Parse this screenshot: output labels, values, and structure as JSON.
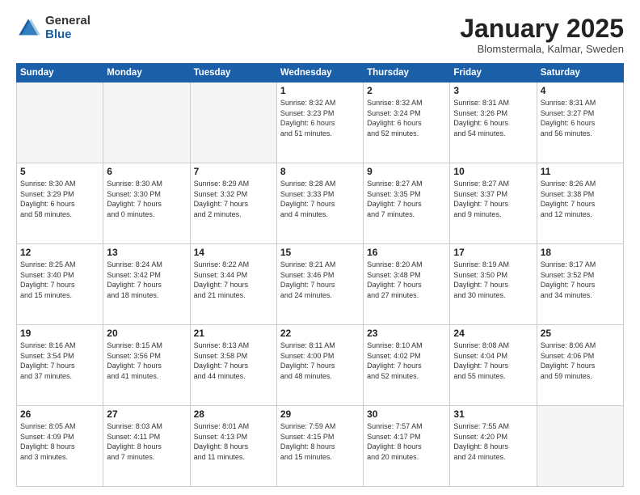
{
  "logo": {
    "general": "General",
    "blue": "Blue"
  },
  "header": {
    "month": "January 2025",
    "location": "Blomstermala, Kalmar, Sweden"
  },
  "days_of_week": [
    "Sunday",
    "Monday",
    "Tuesday",
    "Wednesday",
    "Thursday",
    "Friday",
    "Saturday"
  ],
  "weeks": [
    [
      {
        "day": "",
        "info": ""
      },
      {
        "day": "",
        "info": ""
      },
      {
        "day": "",
        "info": ""
      },
      {
        "day": "1",
        "info": "Sunrise: 8:32 AM\nSunset: 3:23 PM\nDaylight: 6 hours\nand 51 minutes."
      },
      {
        "day": "2",
        "info": "Sunrise: 8:32 AM\nSunset: 3:24 PM\nDaylight: 6 hours\nand 52 minutes."
      },
      {
        "day": "3",
        "info": "Sunrise: 8:31 AM\nSunset: 3:26 PM\nDaylight: 6 hours\nand 54 minutes."
      },
      {
        "day": "4",
        "info": "Sunrise: 8:31 AM\nSunset: 3:27 PM\nDaylight: 6 hours\nand 56 minutes."
      }
    ],
    [
      {
        "day": "5",
        "info": "Sunrise: 8:30 AM\nSunset: 3:29 PM\nDaylight: 6 hours\nand 58 minutes."
      },
      {
        "day": "6",
        "info": "Sunrise: 8:30 AM\nSunset: 3:30 PM\nDaylight: 7 hours\nand 0 minutes."
      },
      {
        "day": "7",
        "info": "Sunrise: 8:29 AM\nSunset: 3:32 PM\nDaylight: 7 hours\nand 2 minutes."
      },
      {
        "day": "8",
        "info": "Sunrise: 8:28 AM\nSunset: 3:33 PM\nDaylight: 7 hours\nand 4 minutes."
      },
      {
        "day": "9",
        "info": "Sunrise: 8:27 AM\nSunset: 3:35 PM\nDaylight: 7 hours\nand 7 minutes."
      },
      {
        "day": "10",
        "info": "Sunrise: 8:27 AM\nSunset: 3:37 PM\nDaylight: 7 hours\nand 9 minutes."
      },
      {
        "day": "11",
        "info": "Sunrise: 8:26 AM\nSunset: 3:38 PM\nDaylight: 7 hours\nand 12 minutes."
      }
    ],
    [
      {
        "day": "12",
        "info": "Sunrise: 8:25 AM\nSunset: 3:40 PM\nDaylight: 7 hours\nand 15 minutes."
      },
      {
        "day": "13",
        "info": "Sunrise: 8:24 AM\nSunset: 3:42 PM\nDaylight: 7 hours\nand 18 minutes."
      },
      {
        "day": "14",
        "info": "Sunrise: 8:22 AM\nSunset: 3:44 PM\nDaylight: 7 hours\nand 21 minutes."
      },
      {
        "day": "15",
        "info": "Sunrise: 8:21 AM\nSunset: 3:46 PM\nDaylight: 7 hours\nand 24 minutes."
      },
      {
        "day": "16",
        "info": "Sunrise: 8:20 AM\nSunset: 3:48 PM\nDaylight: 7 hours\nand 27 minutes."
      },
      {
        "day": "17",
        "info": "Sunrise: 8:19 AM\nSunset: 3:50 PM\nDaylight: 7 hours\nand 30 minutes."
      },
      {
        "day": "18",
        "info": "Sunrise: 8:17 AM\nSunset: 3:52 PM\nDaylight: 7 hours\nand 34 minutes."
      }
    ],
    [
      {
        "day": "19",
        "info": "Sunrise: 8:16 AM\nSunset: 3:54 PM\nDaylight: 7 hours\nand 37 minutes."
      },
      {
        "day": "20",
        "info": "Sunrise: 8:15 AM\nSunset: 3:56 PM\nDaylight: 7 hours\nand 41 minutes."
      },
      {
        "day": "21",
        "info": "Sunrise: 8:13 AM\nSunset: 3:58 PM\nDaylight: 7 hours\nand 44 minutes."
      },
      {
        "day": "22",
        "info": "Sunrise: 8:11 AM\nSunset: 4:00 PM\nDaylight: 7 hours\nand 48 minutes."
      },
      {
        "day": "23",
        "info": "Sunrise: 8:10 AM\nSunset: 4:02 PM\nDaylight: 7 hours\nand 52 minutes."
      },
      {
        "day": "24",
        "info": "Sunrise: 8:08 AM\nSunset: 4:04 PM\nDaylight: 7 hours\nand 55 minutes."
      },
      {
        "day": "25",
        "info": "Sunrise: 8:06 AM\nSunset: 4:06 PM\nDaylight: 7 hours\nand 59 minutes."
      }
    ],
    [
      {
        "day": "26",
        "info": "Sunrise: 8:05 AM\nSunset: 4:09 PM\nDaylight: 8 hours\nand 3 minutes."
      },
      {
        "day": "27",
        "info": "Sunrise: 8:03 AM\nSunset: 4:11 PM\nDaylight: 8 hours\nand 7 minutes."
      },
      {
        "day": "28",
        "info": "Sunrise: 8:01 AM\nSunset: 4:13 PM\nDaylight: 8 hours\nand 11 minutes."
      },
      {
        "day": "29",
        "info": "Sunrise: 7:59 AM\nSunset: 4:15 PM\nDaylight: 8 hours\nand 15 minutes."
      },
      {
        "day": "30",
        "info": "Sunrise: 7:57 AM\nSunset: 4:17 PM\nDaylight: 8 hours\nand 20 minutes."
      },
      {
        "day": "31",
        "info": "Sunrise: 7:55 AM\nSunset: 4:20 PM\nDaylight: 8 hours\nand 24 minutes."
      },
      {
        "day": "",
        "info": ""
      }
    ]
  ]
}
